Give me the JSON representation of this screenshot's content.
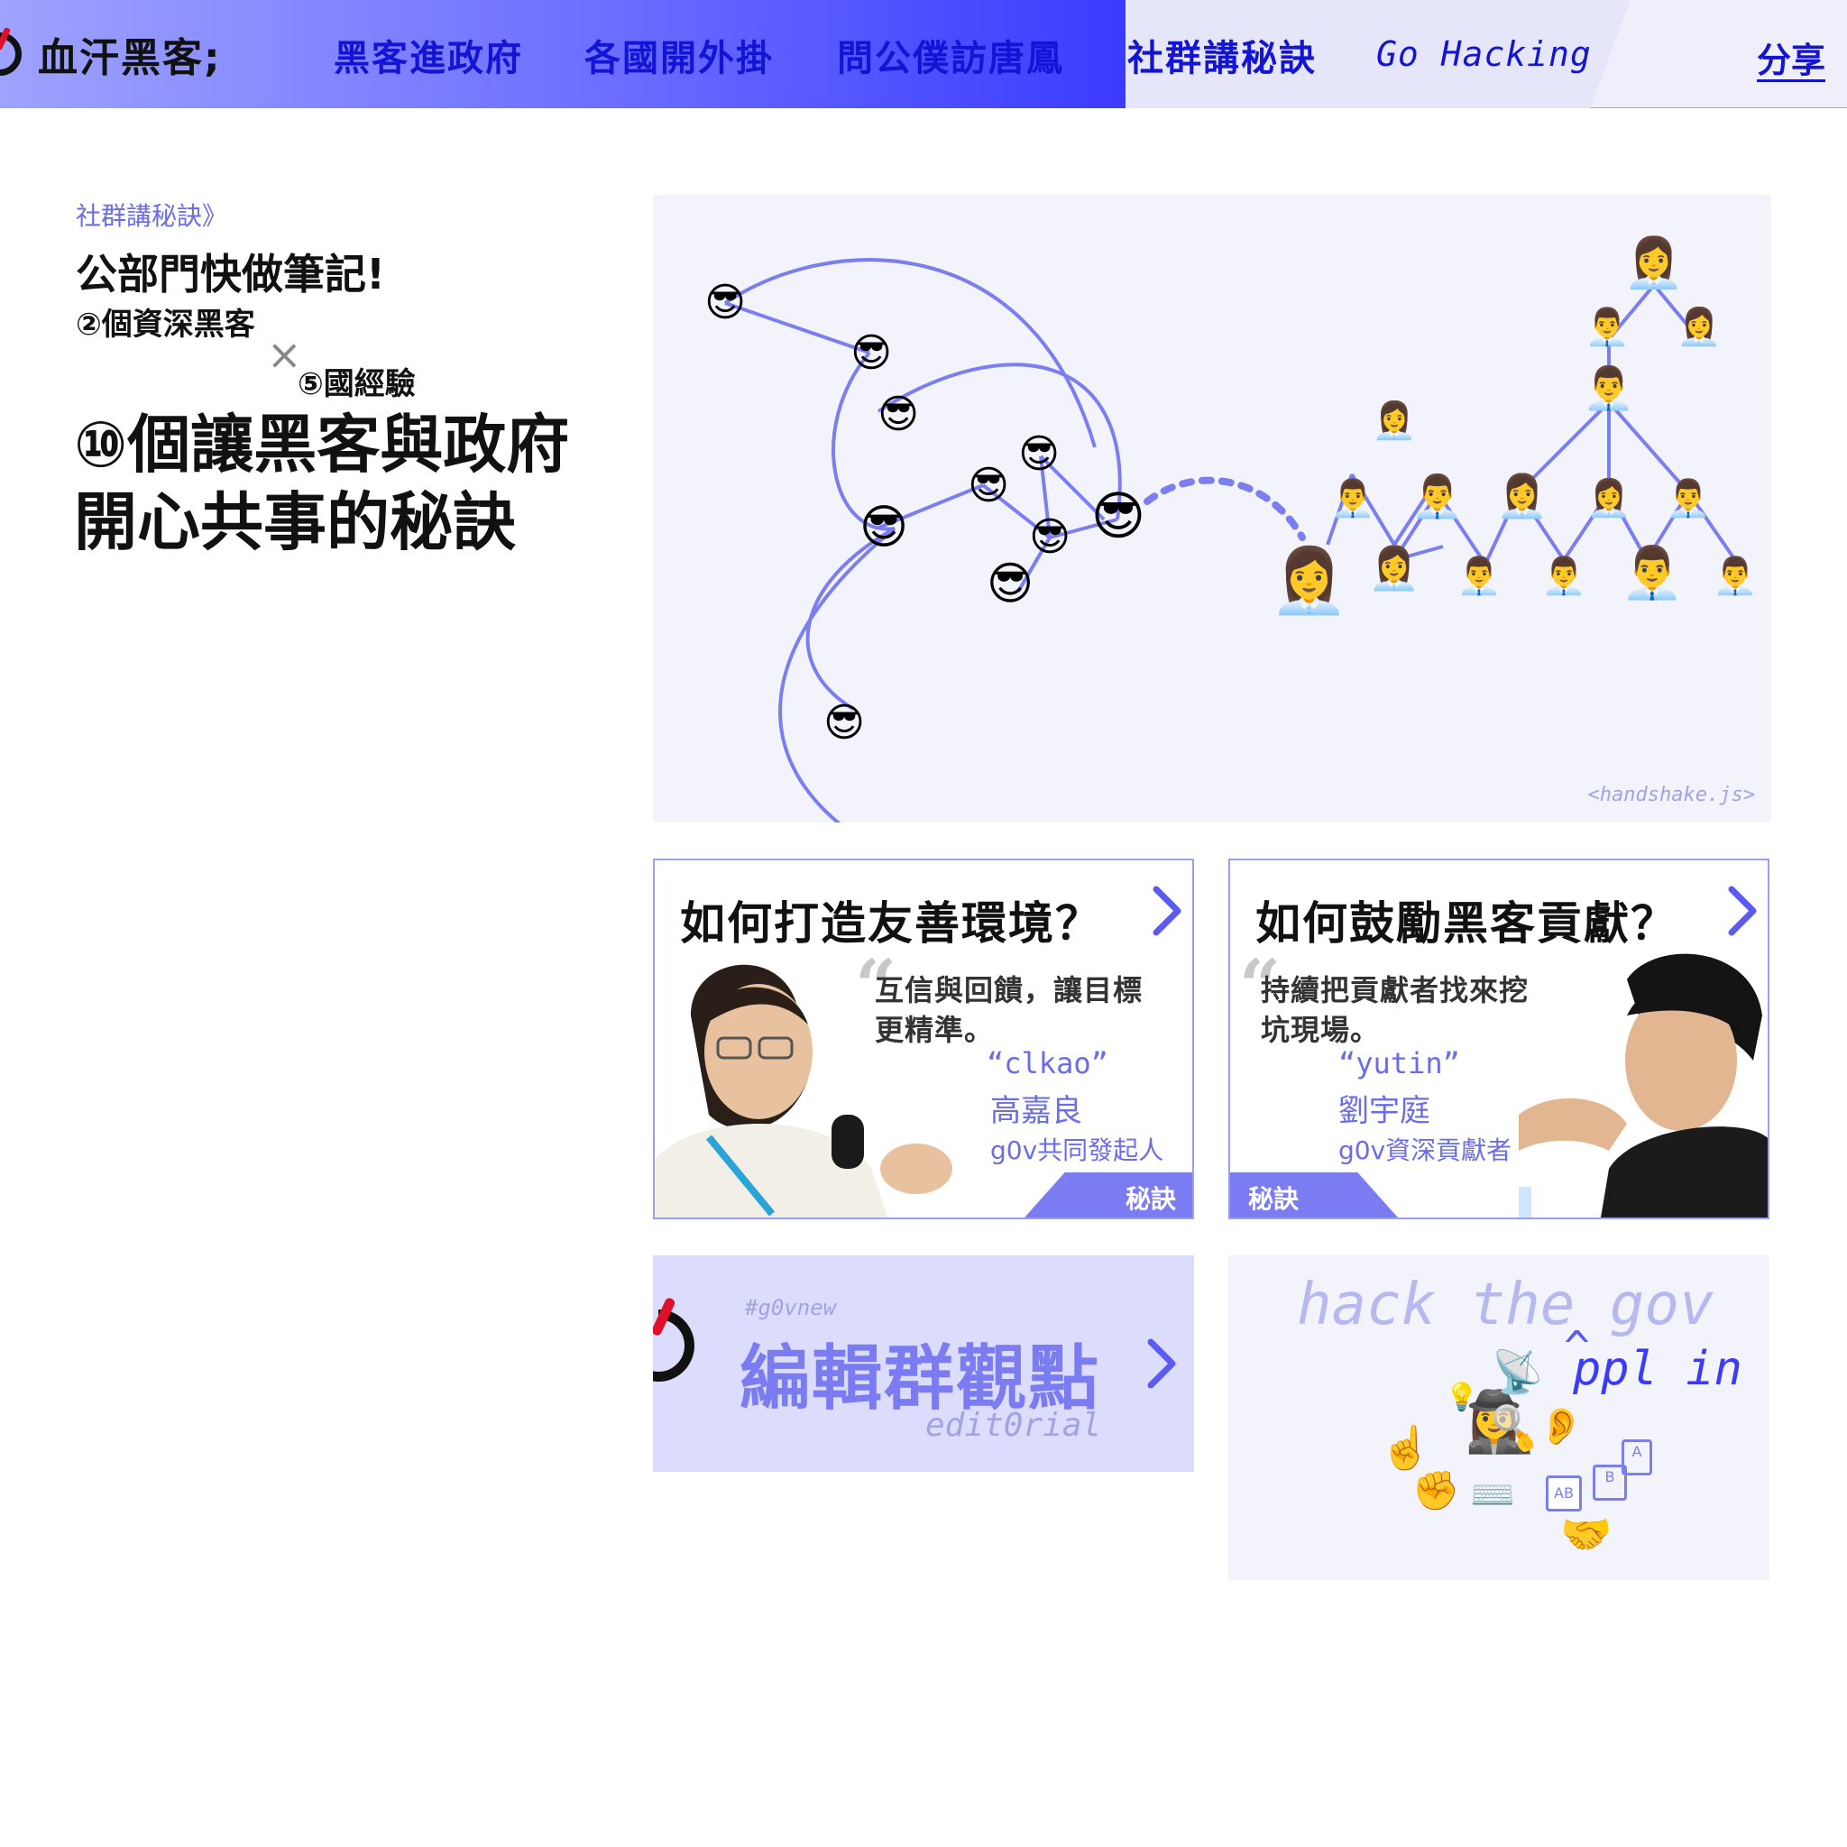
{
  "nav": {
    "brand": "血汗黑客;",
    "items": [
      "黑客進政府",
      "各國開外掛",
      "問公僕訪唐鳳",
      "社群講秘訣",
      "Go Hacking"
    ],
    "share": "分享"
  },
  "intro": {
    "breadcrumb": "社群講秘訣》",
    "subtitle": "公部門快做筆記!",
    "count_hackers": "②個資深黑客",
    "cross": "×",
    "count_countries": "⑤國經驗",
    "headline_line1": "⑩個讓黑客與政府",
    "headline_line2": "開心共事的秘訣"
  },
  "hero": {
    "caption": "<handshake.js>",
    "icons": {
      "cool": "😎",
      "woman": "👩‍💼",
      "man": "👨‍💼"
    }
  },
  "cards": [
    {
      "title": "如何打造友善環境？",
      "quote_line1": "互信與回饋，讓目標",
      "quote_line2": "更精準。",
      "handle": "“clkao”",
      "name": "高嘉良",
      "role": "g0v共同發起人",
      "tag": "秘訣"
    },
    {
      "title": "如何鼓勵黑客貢獻？",
      "quote_line1": "持續把貢獻者找來挖",
      "quote_line2": "坑現場。",
      "handle": "“yutin”",
      "name": "劉宇庭",
      "role": "g0v資深貢獻者",
      "tag": "秘訣"
    }
  ],
  "editorial": {
    "hashtag": "#g0vnew",
    "title": "編輯群觀點",
    "subtitle": "edit0rial"
  },
  "hack": {
    "line1": "hack the gov",
    "caret": "^",
    "line2": "ppl in",
    "emoji": {
      "point": "☝️",
      "fist": "✊",
      "keyboard": "⌨️",
      "detective": "🕵️‍♀️",
      "dish": "📡",
      "bulb": "💡",
      "ear": "👂",
      "handshake": "🤝",
      "bubble_ab": "AB",
      "bubble_b": "B",
      "bubble_a": "A"
    }
  },
  "colors": {
    "accent": "#1414d6",
    "lavender": "#7b7cf2",
    "line": "#7b7ef0",
    "bg_tint": "#f3f3fc"
  }
}
